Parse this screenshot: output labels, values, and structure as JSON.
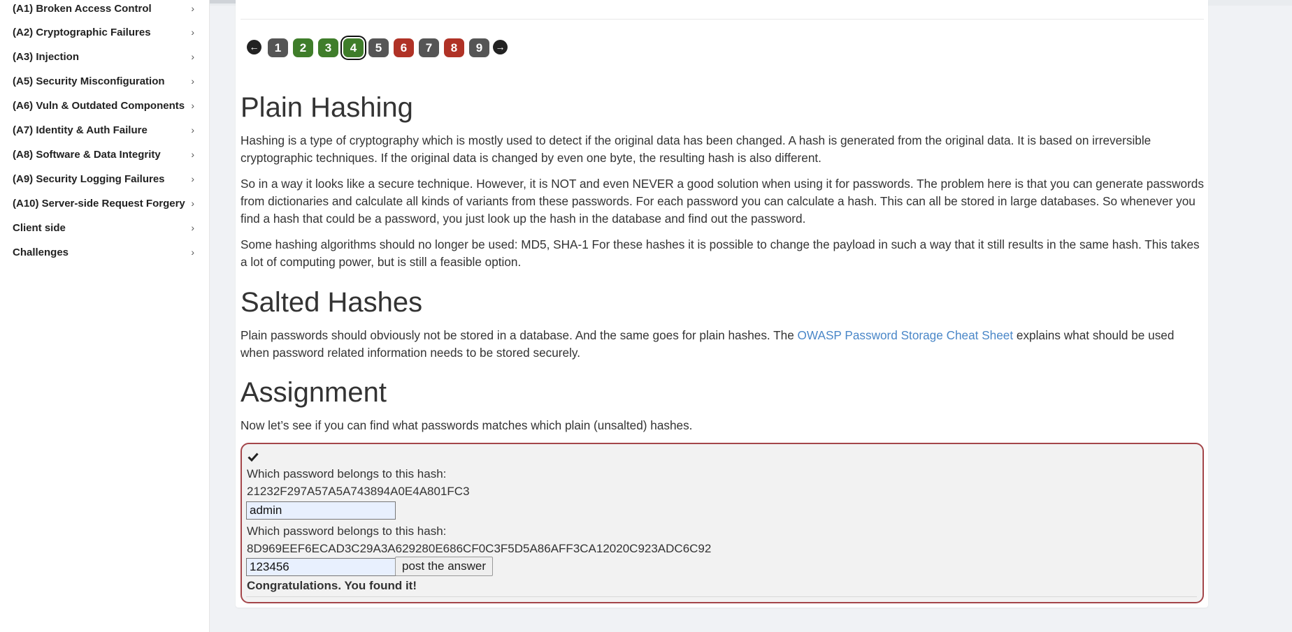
{
  "sidebar": {
    "items": [
      {
        "label": "(A1) Broken Access Control",
        "chevron": "›"
      },
      {
        "label": "(A2) Cryptographic Failures",
        "chevron": "›"
      },
      {
        "label": "(A3) Injection",
        "chevron": "›"
      },
      {
        "label": "(A5) Security Misconfiguration",
        "chevron": "›"
      },
      {
        "label": "(A6) Vuln & Outdated Components",
        "chevron": "›"
      },
      {
        "label": "(A7) Identity & Auth Failure",
        "chevron": "›"
      },
      {
        "label": "(A8) Software & Data Integrity",
        "chevron": "›"
      },
      {
        "label": "(A9) Security Logging Failures",
        "chevron": "›"
      },
      {
        "label": "(A10) Server-side Request Forgery",
        "chevron": "›"
      },
      {
        "label": "Client side",
        "chevron": "›"
      },
      {
        "label": "Challenges",
        "chevron": "›"
      }
    ]
  },
  "pager": {
    "prev_icon": "←",
    "next_icon": "→",
    "pages": [
      {
        "label": "1",
        "state": "gray"
      },
      {
        "label": "2",
        "state": "green"
      },
      {
        "label": "3",
        "state": "green"
      },
      {
        "label": "4",
        "state": "green",
        "active": true
      },
      {
        "label": "5",
        "state": "gray"
      },
      {
        "label": "6",
        "state": "red"
      },
      {
        "label": "7",
        "state": "gray"
      },
      {
        "label": "8",
        "state": "red"
      },
      {
        "label": "9",
        "state": "gray"
      }
    ]
  },
  "lesson": {
    "plain_title": "Plain Hashing",
    "plain_p1": "Hashing is a type of cryptography which is mostly used to detect if the original data has been changed. A hash is generated from the original data. It is based on irreversible cryptographic techniques. If the original data is changed by even one byte, the resulting hash is also different.",
    "plain_p2": "So in a way it looks like a secure technique. However, it is NOT and even NEVER a good solution when using it for passwords. The problem here is that you can generate passwords from dictionaries and calculate all kinds of variants from these passwords. For each password you can calculate a hash. This can all be stored in large databases. So whenever you find a hash that could be a password, you just look up the hash in the database and find out the password.",
    "plain_p3": "Some hashing algorithms should no longer be used: MD5, SHA-1 For these hashes it is possible to change the payload in such a way that it still results in the same hash. This takes a lot of computing power, but is still a feasible option.",
    "salted_title": "Salted Hashes",
    "salted_p_before": "Plain passwords should obviously not be stored in a database. And the same goes for plain hashes. The ",
    "salted_link": "OWASP Password Storage Cheat Sheet",
    "salted_p_after": " explains what should be used when password related information needs to be stored securely.",
    "assign_title": "Assignment",
    "assign_intro": "Now let’s see if you can find what passwords matches which plain (unsalted) hashes."
  },
  "assignment": {
    "q1_label": "Which password belongs to this hash:",
    "q1_hash": "21232F297A57A5A743894A0E4A801FC3",
    "q1_value": "admin",
    "q2_label": "Which password belongs to this hash:",
    "q2_hash": "8D969EEF6ECAD3C29A3A629280E686CF0C3F5D5A86AFF3CA12020C923ADC6C92",
    "q2_value": "123456",
    "submit_label": "post the answer",
    "result": "Congratulations. You found it!"
  },
  "colors": {
    "page_green": "#3f7d2a",
    "page_red": "#b03226",
    "page_gray": "#555555",
    "link": "#4a87c8",
    "assignment_border": "#a4464a"
  }
}
